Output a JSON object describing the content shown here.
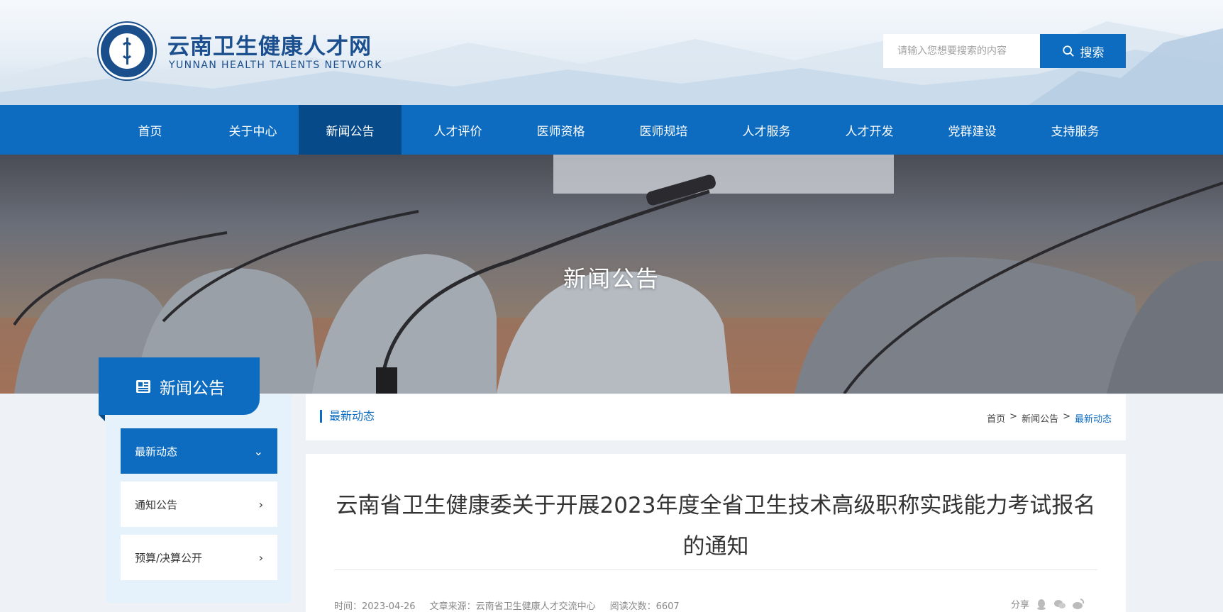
{
  "header": {
    "site_title": "云南卫生健康人才网",
    "site_subtitle": "YUNNAN HEALTH TALENTS NETWORK",
    "search_placeholder": "请输入您想要搜索的内容",
    "search_button": "搜索"
  },
  "nav": {
    "items": [
      {
        "label": "首页"
      },
      {
        "label": "关于中心"
      },
      {
        "label": "新闻公告"
      },
      {
        "label": "人才评价"
      },
      {
        "label": "医师资格"
      },
      {
        "label": "医师规培"
      },
      {
        "label": "人才服务"
      },
      {
        "label": "人才开发"
      },
      {
        "label": "党群建设"
      },
      {
        "label": "支持服务"
      }
    ],
    "active": "新闻公告"
  },
  "banner": {
    "title": "新闻公告"
  },
  "sidebar": {
    "heading": "新闻公告",
    "items": [
      {
        "label": "最新动态",
        "active": true
      },
      {
        "label": "通知公告",
        "active": false
      },
      {
        "label": "预算/决算公开",
        "active": false
      }
    ]
  },
  "breadcrumb": {
    "section_title": "最新动态",
    "home": "首页",
    "level1": "新闻公告",
    "current": "最新动态",
    "separator": ">"
  },
  "article": {
    "title": "云南省卫生健康委关于开展2023年度全省卫生技术高级职称实践能力考试报名的通知",
    "time_label": "时间：2023-04-26",
    "source_label": "文章来源：云南省卫生健康人才交流中心",
    "views_label": "阅读次数：6607",
    "share_label": "分享"
  },
  "colors": {
    "primary": "#0d6cc0",
    "primary_dark": "#064a8a",
    "sidebar_panel": "#e6f2fb"
  }
}
